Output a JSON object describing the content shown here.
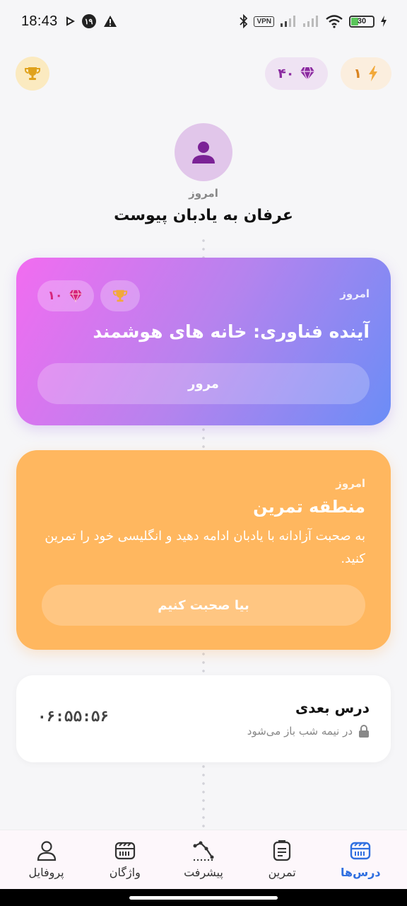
{
  "status_bar": {
    "time": "18:43",
    "notification_badge": "۱۹",
    "vpn_label": "VPN",
    "battery": "30"
  },
  "top_bar": {
    "gems": "۴۰",
    "streak": "۱"
  },
  "header": {
    "subtitle": "امروز",
    "title": "عرفان به یادبان پیوست"
  },
  "lesson_card": {
    "date": "امروز",
    "title": "آینده فناوری: خانه های هوشمند",
    "gems": "۱۰",
    "button_label": "مرور"
  },
  "practice_card": {
    "date": "امروز",
    "title": "منطقه تمرین",
    "description": "به صحبت آزادانه با یادبان ادامه دهید و انگلیسی خود را تمرین کنید.",
    "button_label": "بیا صحبت کنیم"
  },
  "next_lesson": {
    "title": "درس بعدی",
    "subtitle": "در نیمه شب باز می‌شود",
    "countdown": "۰۶:۵۵:۵۶"
  },
  "bottom_nav": {
    "items": [
      {
        "label": "درس‌ها",
        "active": true
      },
      {
        "label": "تمرین",
        "active": false
      },
      {
        "label": "پیشرفت",
        "active": false
      },
      {
        "label": "واژگان",
        "active": false
      },
      {
        "label": "پروفایل",
        "active": false
      }
    ]
  },
  "colors": {
    "accent": "#2f6fe0",
    "lesson_gradient_start": "#f26cf0",
    "lesson_gradient_end": "#6b8df6",
    "practice": "#ffb75f",
    "gem": "#8b2ba0",
    "streak": "#d9831f"
  }
}
